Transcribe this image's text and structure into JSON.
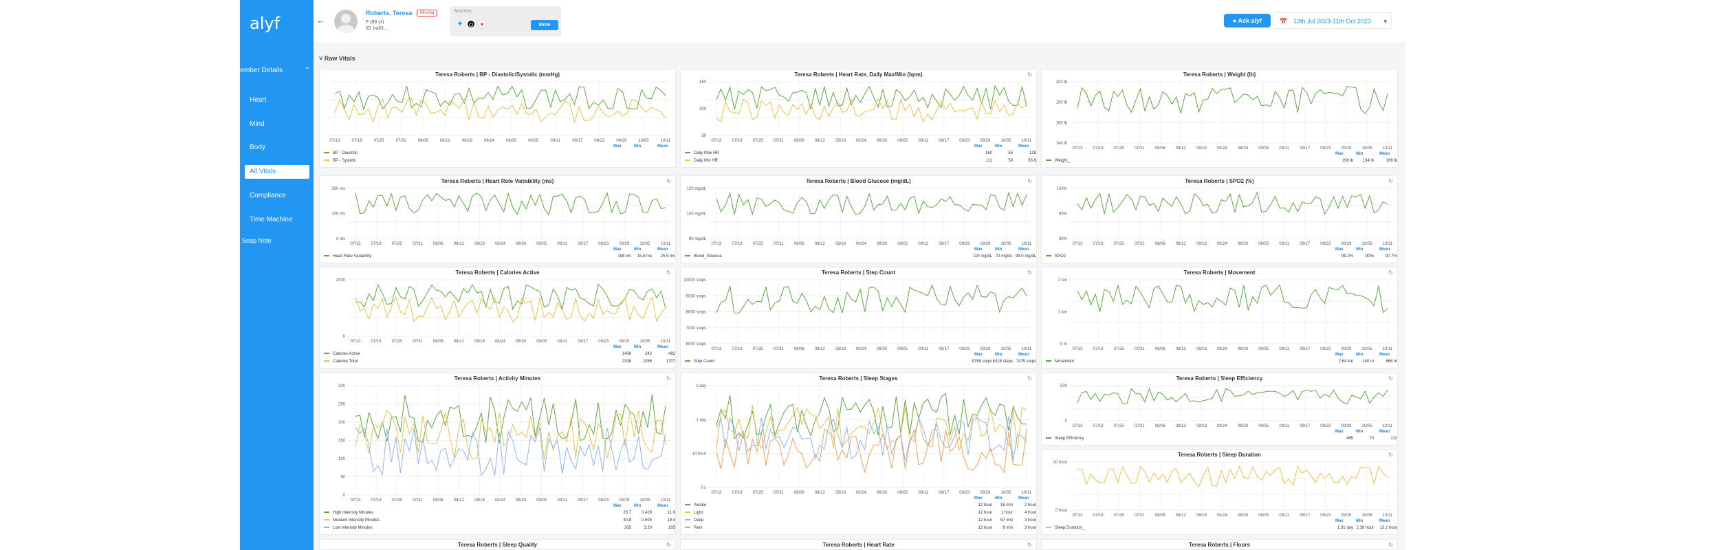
{
  "app": {
    "logo": "alyf"
  },
  "sidebar": {
    "section_label": "Member Details",
    "items": [
      {
        "label": "Heart"
      },
      {
        "label": "Mind"
      },
      {
        "label": "Body"
      },
      {
        "label": "All Vitals",
        "active": true
      },
      {
        "label": "Compliance"
      },
      {
        "label": "Time Machine"
      }
    ],
    "soap_label": "Soap Note"
  },
  "header": {
    "patient_name": "Roberts, Teresa",
    "status_badge": "Missing",
    "gender_age": "F (86 yr)",
    "patient_id": "ID: ba01...",
    "sources_label": "Sources",
    "more_label": "More",
    "ask_label": "Ask alyf",
    "date_range": "13th Jul 2023-11th Oct 2023"
  },
  "section_title": "Raw Vitals",
  "colors": {
    "accent": "#2196f3",
    "green": "#5aa93f",
    "yellow": "#e8c24a",
    "blue": "#8ab4f8",
    "red": "#e53935",
    "orange": "#f0a05a"
  },
  "x_ticks": [
    "07/13",
    "07/19",
    "07/25",
    "07/31",
    "08/06",
    "08/12",
    "08/18",
    "08/24",
    "08/30",
    "09/05",
    "09/11",
    "09/17",
    "09/23",
    "09/29",
    "10/05",
    "10/11"
  ],
  "stat_labels": {
    "max": "Max",
    "min": "Min",
    "mean": "Mean"
  },
  "panels": [
    {
      "title": "Teresa Roberts | BP - Diastolic/Systolic (mmHg)",
      "refresh": false,
      "y_ticks": [],
      "legend": [
        {
          "name": "BP - Diastolic",
          "color": "#5aa93f",
          "max": "",
          "min": "",
          "mean": ""
        },
        {
          "name": "BP - Systolic",
          "color": "#e8c24a",
          "max": "",
          "min": "",
          "mean": ""
        }
      ]
    },
    {
      "title": "Teresa Roberts | Heart Rate, Daily Max/Min (bpm)",
      "refresh": true,
      "y_ticks": [
        "150",
        "100",
        "50"
      ],
      "legend": [
        {
          "name": "Daily Max HR",
          "color": "#5aa93f",
          "max": "160",
          "min": "55",
          "mean": "128"
        },
        {
          "name": "Daily Min HR",
          "color": "#e8c24a",
          "max": "111",
          "min": "50",
          "mean": "63.9"
        }
      ]
    },
    {
      "title": "Teresa Roberts | Weight (lb)",
      "refresh": false,
      "y_ticks": [
        "200 lb",
        "180 lb",
        "160 lb",
        "140 lb"
      ],
      "legend": [
        {
          "name": "Weight_",
          "color": "#5aa93f",
          "max": "198 lb",
          "min": "134 lb",
          "mean": "168 lb"
        }
      ]
    },
    {
      "title": "Teresa Roberts | Heart Rate Variability (ms)",
      "refresh": true,
      "y_ticks": [
        "200 ms",
        "100 ms",
        "0 ms"
      ],
      "legend": [
        {
          "name": "Heart Rate Variability",
          "color": "#5aa93f",
          "max": "198 ms",
          "min": "15.8 ms",
          "mean": "25.9 ms"
        }
      ]
    },
    {
      "title": "Teresa Roberts | Blood Glucose (mg/dL)",
      "refresh": true,
      "y_ticks": [
        "120 mg/dL",
        "100 mg/dL",
        "80 mg/dL"
      ],
      "legend": [
        {
          "name": "Blood_Glucose",
          "color": "#5aa93f",
          "max": "119 mg/dL",
          "min": "72 mg/dL",
          "mean": "99.0 mg/dL"
        }
      ]
    },
    {
      "title": "Teresa Roberts | SPO2 (%)",
      "refresh": true,
      "y_ticks": [
        "100%",
        "95%",
        "90%"
      ],
      "legend": [
        {
          "name": "SPO2",
          "color": "#5aa93f",
          "max": "99.2%",
          "min": "90%",
          "mean": "97.7%"
        }
      ]
    },
    {
      "title": "Teresa Roberts | Calories Active",
      "refresh": true,
      "y_ticks": [
        "2000",
        "0"
      ],
      "legend": [
        {
          "name": "Calories Active",
          "color": "#5aa93f",
          "max": "1406",
          "min": "242",
          "mean": "492"
        },
        {
          "name": "Calories Total",
          "color": "#e8c24a",
          "max": "2338",
          "min": "1086",
          "mean": "1707"
        }
      ]
    },
    {
      "title": "Teresa Roberts | Step Count",
      "refresh": true,
      "y_ticks": [
        "10000 steps",
        "9000 steps",
        "8000 steps",
        "7000 steps",
        "6000 steps"
      ],
      "legend": [
        {
          "name": "Step Count",
          "color": "#5aa93f",
          "max": "9789 steps",
          "min": "6328 steps",
          "mean": "7475 steps"
        }
      ]
    },
    {
      "title": "Teresa Roberts | Movement",
      "refresh": true,
      "y_ticks": [
        "2 km",
        "1 km",
        "0 m"
      ],
      "legend": [
        {
          "name": "Movement",
          "color": "#5aa93f",
          "max": "2.64 km",
          "min": "140 m",
          "mean": "668 m"
        }
      ]
    },
    {
      "title": "Teresa Roberts | Activity Minutes",
      "refresh": true,
      "y_ticks": [
        "300",
        "250",
        "200",
        "150",
        "100",
        "50",
        "0"
      ],
      "legend": [
        {
          "name": "High Intensity Minutes",
          "color": "#5aa93f",
          "max": "26.7",
          "min": "0.429",
          "mean": "11.9"
        },
        {
          "name": "Medium Intensity Minutes",
          "color": "#e8c24a",
          "max": "40.8",
          "min": "0.500",
          "mean": "19.4"
        },
        {
          "name": "Low Intensity Minutes",
          "color": "#8ab4f8",
          "max": "205",
          "min": "3.20",
          "mean": "105"
        }
      ]
    },
    {
      "title": "Teresa Roberts | Sleep Stages",
      "refresh": true,
      "y_ticks": [
        "2 day",
        "1 day",
        "14 hour",
        "0 s"
      ],
      "legend": [
        {
          "name": "Awake",
          "color": "#5aa93f",
          "max": "12 hour",
          "min": "16 min",
          "mean": "2 hour"
        },
        {
          "name": "Light",
          "color": "#e8c24a",
          "max": "12 hour",
          "min": "1 hour",
          "mean": "4 hour"
        },
        {
          "name": "Deep",
          "color": "#8ab4f8",
          "max": "12 hour",
          "min": "57 min",
          "mean": "3 hour"
        },
        {
          "name": "Rem",
          "color": "#f0a05a",
          "max": "12 hour",
          "min": "8 min",
          "mean": "3 hour"
        }
      ]
    },
    {
      "title": "Teresa Roberts | Sleep Efficiency",
      "refresh": true,
      "y_ticks": [
        "500",
        "0"
      ],
      "legend": [
        {
          "name": "Sleep Efficiency",
          "color": "#5aa93f",
          "max": "465",
          "min": "70",
          "mean": "112"
        }
      ]
    },
    {
      "title": "Teresa Roberts | Sleep Duration",
      "refresh": true,
      "y_ticks": [
        "20 hour",
        "0 hour"
      ],
      "legend": [
        {
          "name": "Sleep Duration_",
          "color": "#e8c24a",
          "max": "1.31 day",
          "min": "2.38 hour",
          "mean": "13.2 hour"
        }
      ]
    },
    {
      "title": "Teresa Roberts | Sleep Quality",
      "refresh": true,
      "y_ticks": [],
      "legend": []
    },
    {
      "title": "Teresa Roberts | Heart Rate",
      "refresh": true,
      "y_ticks": [],
      "legend": []
    },
    {
      "title": "Teresa Roberts | Floors",
      "refresh": true,
      "y_ticks": [],
      "legend": []
    }
  ]
}
